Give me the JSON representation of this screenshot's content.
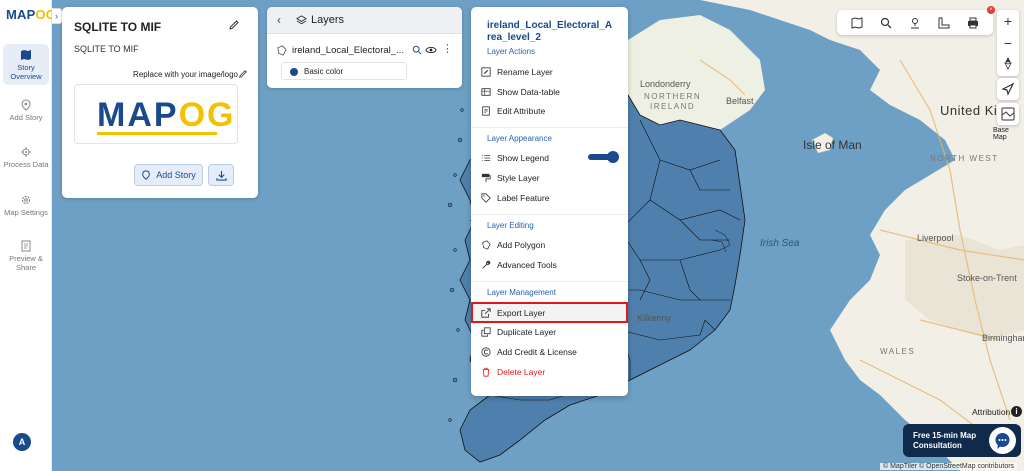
{
  "sidebar": {
    "logo_main": "MAP",
    "logo_accent": "OG",
    "items": [
      {
        "label": "Story Overview",
        "icon": "map-icon"
      },
      {
        "label": "Add Story",
        "icon": "pin-icon"
      },
      {
        "label": "Process Data",
        "icon": "gear-network-icon"
      },
      {
        "label": "Map Settings",
        "icon": "settings-icon"
      },
      {
        "label": "Preview & Share",
        "icon": "document-icon"
      }
    ],
    "avatar_letter": "A"
  },
  "story": {
    "title": "SQLITE TO MIF",
    "subtitle": "SQLITE TO MIF",
    "replace_logo": "Replace with your image/logo",
    "logo_main": "MAP",
    "logo_accent": "OG",
    "add_story": "Add Story"
  },
  "layers": {
    "title": "Layers",
    "layer_name": "ireland_Local_Electoral_...",
    "basic_color": "Basic color",
    "color": "#1a4a8c"
  },
  "context_menu": {
    "title": "ireland_Local_Electoral_Area_level_2",
    "sections": {
      "actions": "Layer Actions",
      "appearance": "Layer Appearance",
      "editing": "Layer Editing",
      "management": "Layer Management"
    },
    "items": {
      "rename": "Rename Layer",
      "datatable": "Show Data-table",
      "edit_attr": "Edit Attribute",
      "legend": "Show Legend",
      "style": "Style Layer",
      "label": "Label Feature",
      "polygon": "Add Polygon",
      "advanced": "Advanced Tools",
      "export": "Export Layer",
      "duplicate": "Duplicate Layer",
      "credit": "Add Credit & License",
      "delete": "Delete Layer"
    },
    "legend_on": true
  },
  "map": {
    "labels": {
      "londonderry": "Londonderry",
      "northern_ireland": "NORTHERN\nIRELAND",
      "belfast": "Belfast",
      "isle_of_man": "Isle of Man",
      "united_kingdom": "United Kin",
      "north_west": "NORTH WEST",
      "irish_sea": "Irish Sea",
      "liverpool": "Liverpool",
      "stoke": "Stoke-on-Trent",
      "wales": "WALES",
      "birmingham": "Birmingham",
      "kilkenny": "Kilkenny"
    },
    "basemap_label": "Base Map",
    "attribution": "Attribution",
    "consult": "Free 15-min Map Consultation",
    "credits": "© MapTiler © OpenStreetMap contributors"
  }
}
